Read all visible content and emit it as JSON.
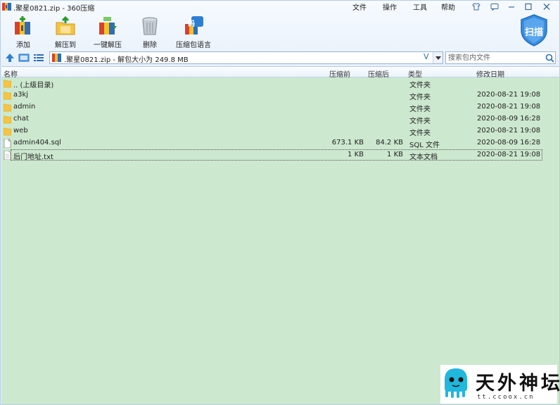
{
  "window": {
    "title": ".聚星0821.zip - 360压缩"
  },
  "menu": [
    "文件",
    "操作",
    "工具",
    "帮助"
  ],
  "toolbar": {
    "add": "添加",
    "extract_to": "解压到",
    "one_click_extract": "一键解压",
    "delete": "删除",
    "language": "压缩包语言",
    "language_badge": "码",
    "scan": "扫描"
  },
  "address": {
    "path": ".聚星0821.zip - 解包大小为 249.8 MB",
    "history_glyph": "V"
  },
  "search": {
    "placeholder": "搜索包内文件"
  },
  "columns": {
    "name": "名称",
    "compressed_before": "压缩前",
    "compressed_after": "压缩后",
    "type": "类型",
    "modified": "修改日期"
  },
  "files": [
    {
      "name": ".. (上级目录)",
      "before": "",
      "after": "",
      "type": "文件夹",
      "date": "",
      "kind": "folder"
    },
    {
      "name": "a3kj",
      "before": "",
      "after": "",
      "type": "文件夹",
      "date": "2020-08-21 19:08",
      "kind": "folder"
    },
    {
      "name": "admin",
      "before": "",
      "after": "",
      "type": "文件夹",
      "date": "2020-08-21 19:08",
      "kind": "folder"
    },
    {
      "name": "chat",
      "before": "",
      "after": "",
      "type": "文件夹",
      "date": "2020-08-09 16:28",
      "kind": "folder"
    },
    {
      "name": "web",
      "before": "",
      "after": "",
      "type": "文件夹",
      "date": "2020-08-21 19:08",
      "kind": "folder"
    },
    {
      "name": "admin404.sql",
      "before": "673.1 KB",
      "after": "84.2 KB",
      "type": "SQL 文件",
      "date": "2020-08-09 16:28",
      "kind": "file"
    },
    {
      "name": "后门地址.txt",
      "before": "1 KB",
      "after": "1 KB",
      "type": "文本文档",
      "date": "2020-08-21 19:08",
      "kind": "file",
      "selected": true
    }
  ],
  "watermark": {
    "name": "天外神坛",
    "url": "tt.ccoox.cn"
  },
  "colors": {
    "list_bg": "#cce8cf",
    "accent": "#2f7fd0",
    "folder": "#f5c542"
  }
}
